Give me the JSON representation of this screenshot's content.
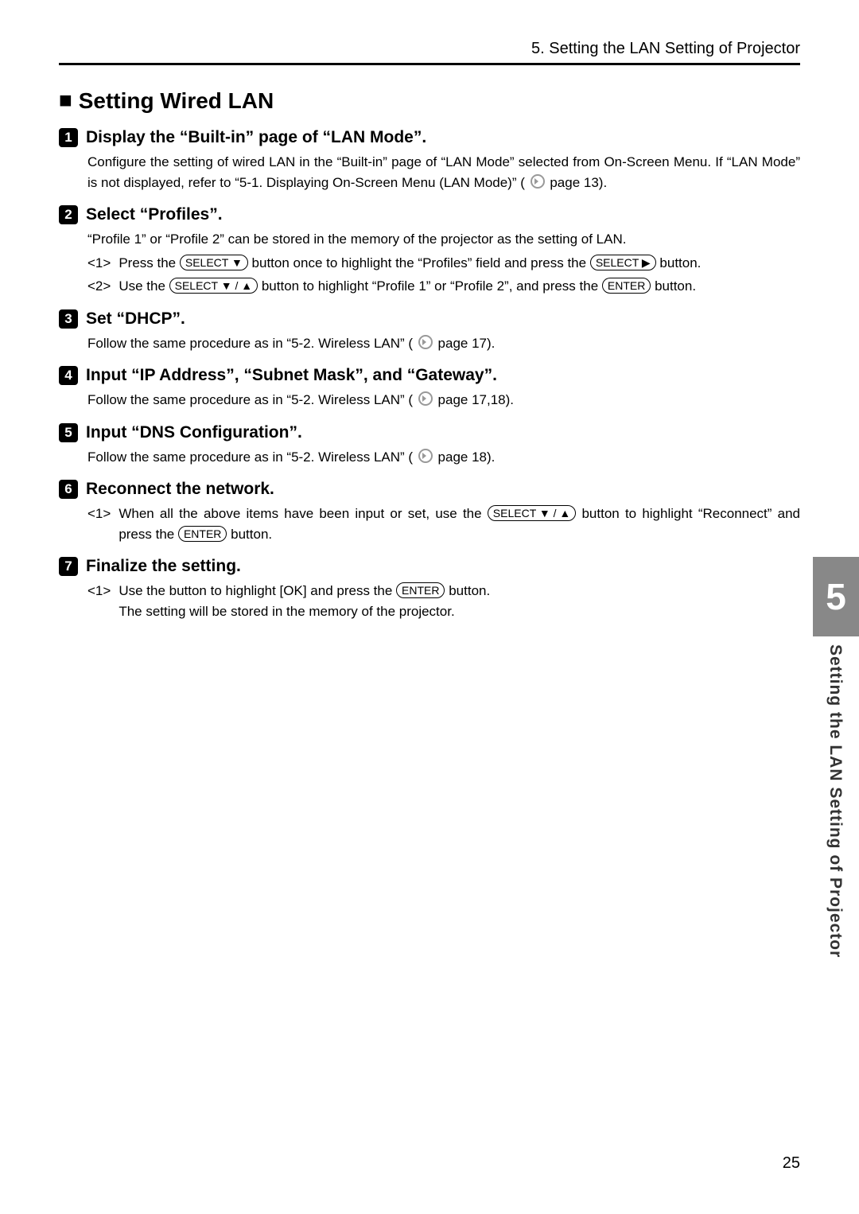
{
  "header": {
    "chapter_breadcrumb": "5. Setting the LAN Setting of Projector"
  },
  "section": {
    "bullet": "■",
    "title": "Setting Wired LAN"
  },
  "steps": [
    {
      "num": "1",
      "heading": "Display the “Built-in” page of “LAN Mode”.",
      "body": "Configure the setting of wired LAN in the “Built-in” page of “LAN Mode” selected from On-Screen Menu. If “LAN Mode” is not displayed, refer to “5-1. Displaying On-Screen Menu (LAN Mode)” ( ",
      "page_ref": " page 13)."
    },
    {
      "num": "2",
      "heading": "Select “Profiles”.",
      "body": "“Profile 1” or “Profile 2” can be stored in the memory of the projector as the setting of LAN.",
      "subs": [
        "<1>",
        "<2>"
      ],
      "sub1_pre": "Press the ",
      "sub1_btn1": "SELECT ▼",
      "sub1_mid": " button once to highlight the “Profiles” field and press the ",
      "sub1_btn2": "SELECT ▶",
      "sub1_post": " button.",
      "sub2_pre": "Use the ",
      "sub2_btn1": "SELECT ▼ / ▲",
      "sub2_mid": " button to highlight “Profile 1” or “Profile 2”, and press the ",
      "sub2_btn2": "ENTER",
      "sub2_post": " button."
    },
    {
      "num": "3",
      "heading": "Set “DHCP”.",
      "body_pre": "Follow the same procedure as in “5-2. Wireless LAN” ( ",
      "body_post": " page 17)."
    },
    {
      "num": "4",
      "heading": "Input “IP Address”, “Subnet Mask”, and “Gateway”.",
      "body_pre": "Follow the same procedure as in “5-2. Wireless LAN” ( ",
      "body_post": " page 17,18)."
    },
    {
      "num": "5",
      "heading": "Input “DNS Configuration”.",
      "body_pre": "Follow the same procedure as in “5-2. Wireless LAN” ( ",
      "body_post": " page 18)."
    },
    {
      "num": "6",
      "heading": "Reconnect the network.",
      "subs": [
        "<1>"
      ],
      "sub1_pre": "When all the above items have been input or set, use the ",
      "sub1_btn1": "SELECT ▼ / ▲",
      "sub1_mid": " button to highlight “Reconnect” and press the ",
      "sub1_btn2": "ENTER",
      "sub1_post": " button."
    },
    {
      "num": "7",
      "heading": "Finalize the setting.",
      "subs": [
        "<1>"
      ],
      "sub1_pre": "Use the  button to highlight [OK] and press the ",
      "sub1_btn1": "ENTER",
      "sub1_post": " button.",
      "sub1_tail": "The setting will be stored in the memory of the projector."
    }
  ],
  "sidebar": {
    "number": "5",
    "label": "Setting the LAN Setting of Projector"
  },
  "page_number": "25"
}
